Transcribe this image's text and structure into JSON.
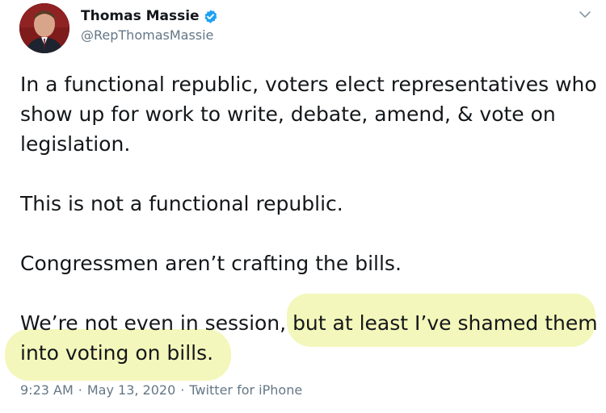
{
  "author": {
    "display_name": "Thomas Massie",
    "handle": "@RepThomasMassie",
    "verified": true,
    "avatar_icon": "profile-photo"
  },
  "menu_icon": "chevron-down-icon",
  "tweet": {
    "paragraphs": [
      "In a functional republic, voters elect representatives who show up for work to write, debate, amend, & vote on legislation.",
      "This is not a functional republic.",
      "Congressmen aren’t crafting the bills."
    ],
    "last_paragraph_plain": "We’re not even in session, ",
    "last_paragraph_highlight_1": "but at least I’ve shamed them",
    "last_paragraph_highlight_2": "into voting on bills."
  },
  "meta": {
    "time": "9:23 AM",
    "date": "May 13, 2020",
    "source": "Twitter for iPhone",
    "separator": "·"
  },
  "colors": {
    "text": "#14171a",
    "secondary": "#657786",
    "verified_blue": "#1da1f2",
    "highlight": "#f0f4a4"
  }
}
